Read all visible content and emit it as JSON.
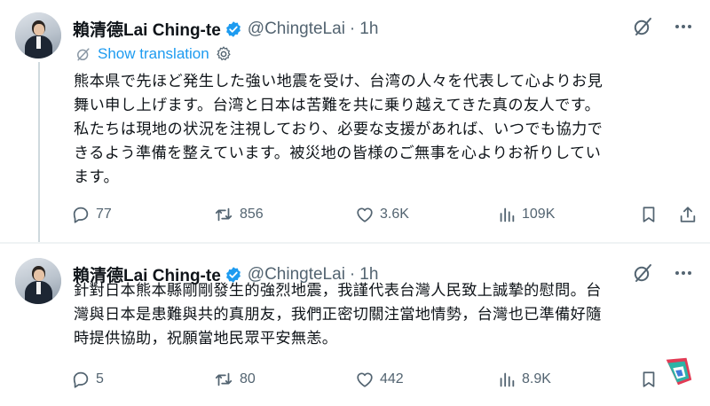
{
  "tweets": [
    {
      "display_name": "賴清德Lai Ching-te",
      "handle": "@ChingteLai",
      "separator": "·",
      "time": "1h",
      "translate_label": "Show translation",
      "lines": [
        "熊本県で先ほど発生した強い地震を受け、台湾の人々を代表して心よりお見",
        "舞い申し上げます。台湾と日本は苦難を共に乗り越えてきた真の友人です。",
        "私たちは現地の状況を注視しており、必要な支援があれば、いつでも協力で",
        "きるよう準備を整えています。被災地の皆様のご無事を心よりお祈りしてい",
        "ます。"
      ],
      "stats": {
        "replies": "77",
        "reposts": "856",
        "likes": "3.6K",
        "views": "109K"
      }
    },
    {
      "display_name": "賴清德Lai Ching-te",
      "handle": "@ChingteLai",
      "separator": "·",
      "time": "1h",
      "lines": [
        "針對日本熊本縣剛剛發生的強烈地震，我謹代表台灣人民致上誠摯的慰問。台",
        "灣與日本是患難與共的真朋友，我們正密切關注當地情勢，台灣也已準備好隨",
        "時提供協助，祝願當地民眾平安無恙。"
      ],
      "stats": {
        "replies": "5",
        "reposts": "80",
        "likes": "442",
        "views": "8.9K"
      }
    }
  ],
  "icons": {
    "verified": "verified-badge-icon",
    "grok": "grok-icon",
    "more": "more-icon",
    "translate": "globe-icon",
    "settings": "gear-icon",
    "reply": "reply-icon",
    "repost": "repost-icon",
    "like": "heart-icon",
    "views": "views-icon",
    "bookmark": "bookmark-icon",
    "share": "share-icon"
  },
  "colors": {
    "accent": "#1d9bf0",
    "secondary_text": "#536471",
    "text": "#0f1419"
  }
}
